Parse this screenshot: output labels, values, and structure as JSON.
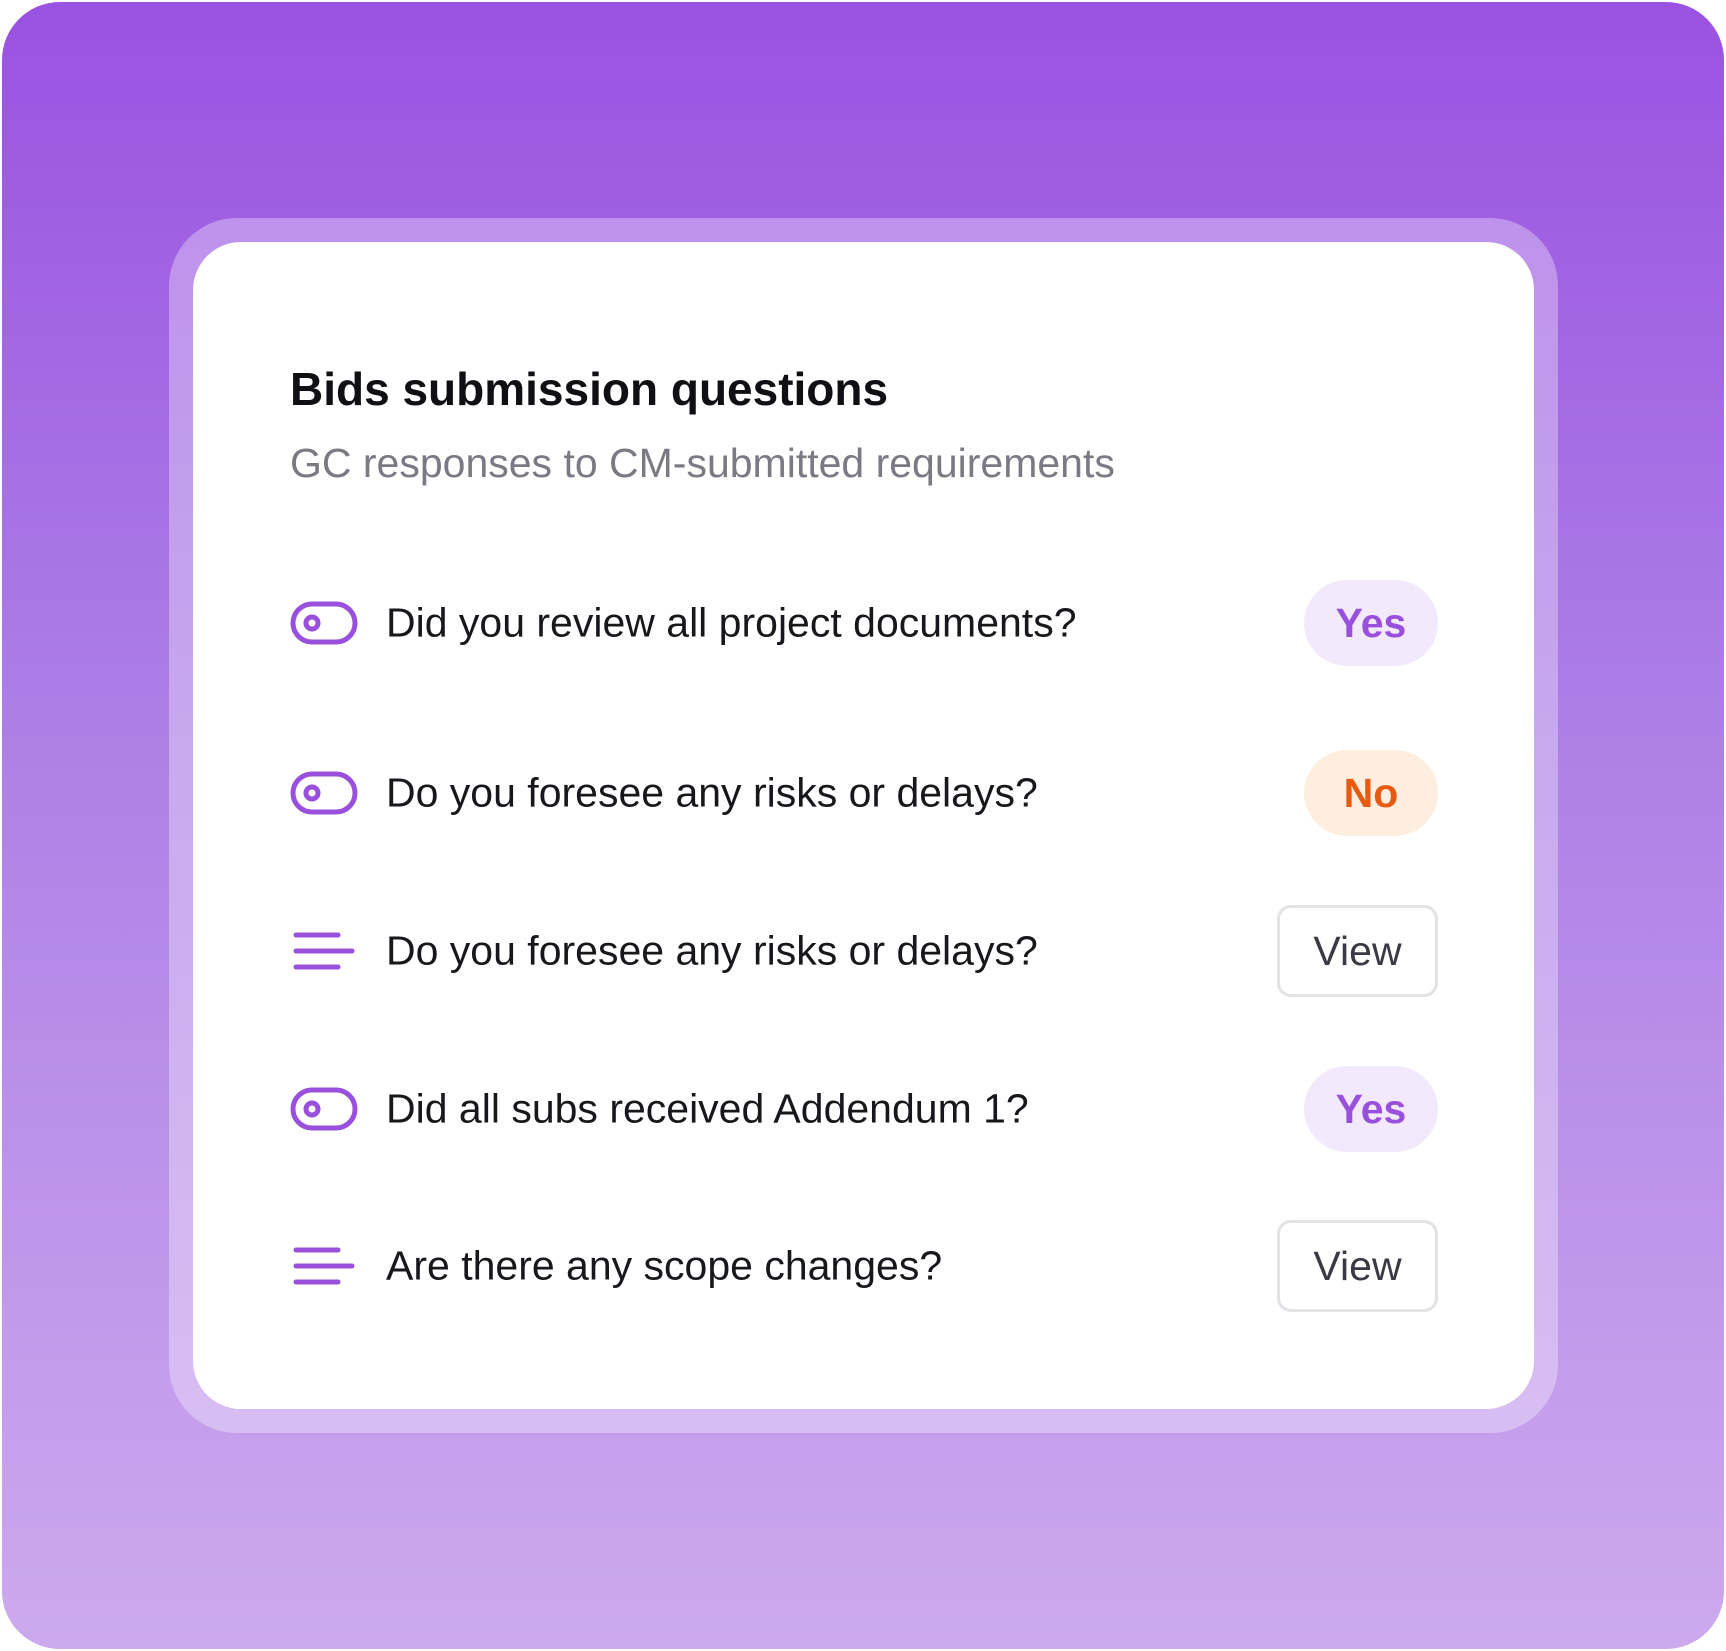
{
  "card": {
    "title": "Bids submission questions",
    "subtitle": "GC responses to CM-submitted requirements"
  },
  "questions": [
    {
      "icon": "toggle-icon",
      "text": "Did you review all project documents?",
      "answer_type": "pill",
      "answer": "Yes"
    },
    {
      "icon": "toggle-icon",
      "text": "Do you foresee any risks or delays?",
      "answer_type": "pill",
      "answer": "No"
    },
    {
      "icon": "text-lines-icon",
      "text": "Do you foresee any risks or delays?",
      "answer_type": "button",
      "answer": "View"
    },
    {
      "icon": "toggle-icon",
      "text": "Did all subs received Addendum 1?",
      "answer_type": "pill",
      "answer": "Yes"
    },
    {
      "icon": "text-lines-icon",
      "text": "Are there any scope changes?",
      "answer_type": "button",
      "answer": "View"
    }
  ],
  "colors": {
    "accent": "#9950dc",
    "yes_bg": "#f3e9fd",
    "no_text": "#e65a12",
    "no_bg": "#fdeedf"
  }
}
